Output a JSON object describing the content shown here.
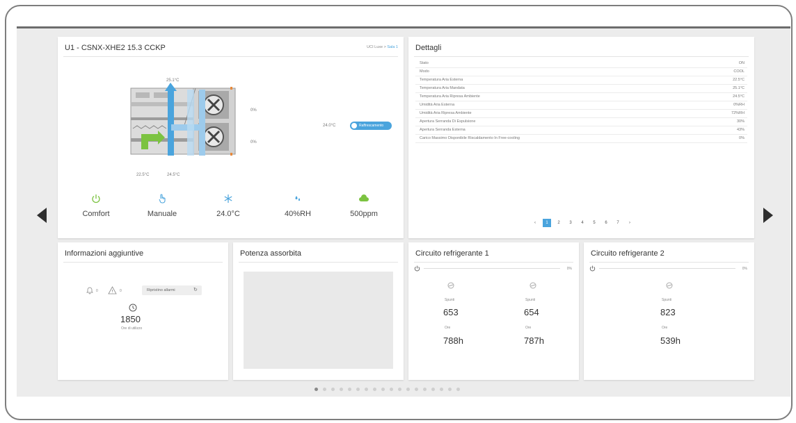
{
  "unit": {
    "title": "U1 - CSNX-XHE2 15.3 CCKP",
    "breadcrumb_part1": "UCI Luxe",
    "breadcrumb_sep": ">",
    "breadcrumb_part2": "Sala 1",
    "temp_supply": "25.1°C",
    "temp_outdoor": "22.5°C",
    "temp_return": "24.5°C",
    "damper_top": "0%",
    "damper_bottom": "0%",
    "setpoint": "24.0°C",
    "mode_toggle": "Raffrescamento",
    "stats": [
      {
        "icon": "power-icon",
        "label": "Comfort",
        "color": "#7cc341"
      },
      {
        "icon": "hand-pointer-icon",
        "label": "Manuale",
        "color": "#4aa4dd"
      },
      {
        "icon": "snowflake-icon",
        "label": "24.0°C",
        "color": "#4aa4dd"
      },
      {
        "icon": "droplets-icon",
        "label": "40%RH",
        "color": "#4aa4dd"
      },
      {
        "icon": "co2-cloud-icon",
        "label": "500ppm",
        "color": "#7cc341"
      }
    ]
  },
  "details": {
    "title": "Dettagli",
    "rows": [
      {
        "k": "Stato",
        "v": "ON"
      },
      {
        "k": "Modo",
        "v": "COOL"
      },
      {
        "k": "Temperatura Aria Esterna",
        "v": "22.5°C"
      },
      {
        "k": "Temperatura Aria Mandata",
        "v": "25.1°C"
      },
      {
        "k": "Temperatura Aria Ripresa Ambiente",
        "v": "24.5°C"
      },
      {
        "k": "Umidità Aria Esterna",
        "v": "0%RH"
      },
      {
        "k": "Umidità Aria Ripresa Ambiente",
        "v": "72%RH"
      },
      {
        "k": "Apertura Serranda Di Espulsione",
        "v": "30%"
      },
      {
        "k": "Apertura Serranda Esterna",
        "v": "43%"
      },
      {
        "k": "Carico Massimo Disponibile Riscaldamento In Free-cooling",
        "v": "0%"
      }
    ],
    "pagination": [
      "‹",
      "1",
      "2",
      "3",
      "4",
      "5",
      "6",
      "7",
      "›"
    ],
    "active_page": "1"
  },
  "info": {
    "title": "Informazioni aggiuntive",
    "bell_count": "0",
    "warn_count": "0",
    "reset_button": "Ripristino allarmi",
    "hours_value": "1850",
    "hours_label": "Ore di utilizzo"
  },
  "power": {
    "title": "Potenza assorbita"
  },
  "circuit1": {
    "title": "Circuito refrigerante 1",
    "percent": "0%",
    "compressors": [
      {
        "starts_label": "Spunti",
        "starts": "653",
        "hours_label": "Ore",
        "hours": "788h"
      },
      {
        "starts_label": "Spunti",
        "starts": "654",
        "hours_label": "Ore",
        "hours": "787h"
      }
    ]
  },
  "circuit2": {
    "title": "Circuito refrigerante 2",
    "percent": "0%",
    "compressors": [
      {
        "starts_label": "Spunti",
        "starts": "823",
        "hours_label": "Ore",
        "hours": "539h"
      }
    ]
  },
  "carousel": {
    "total": 18,
    "active": 0
  }
}
